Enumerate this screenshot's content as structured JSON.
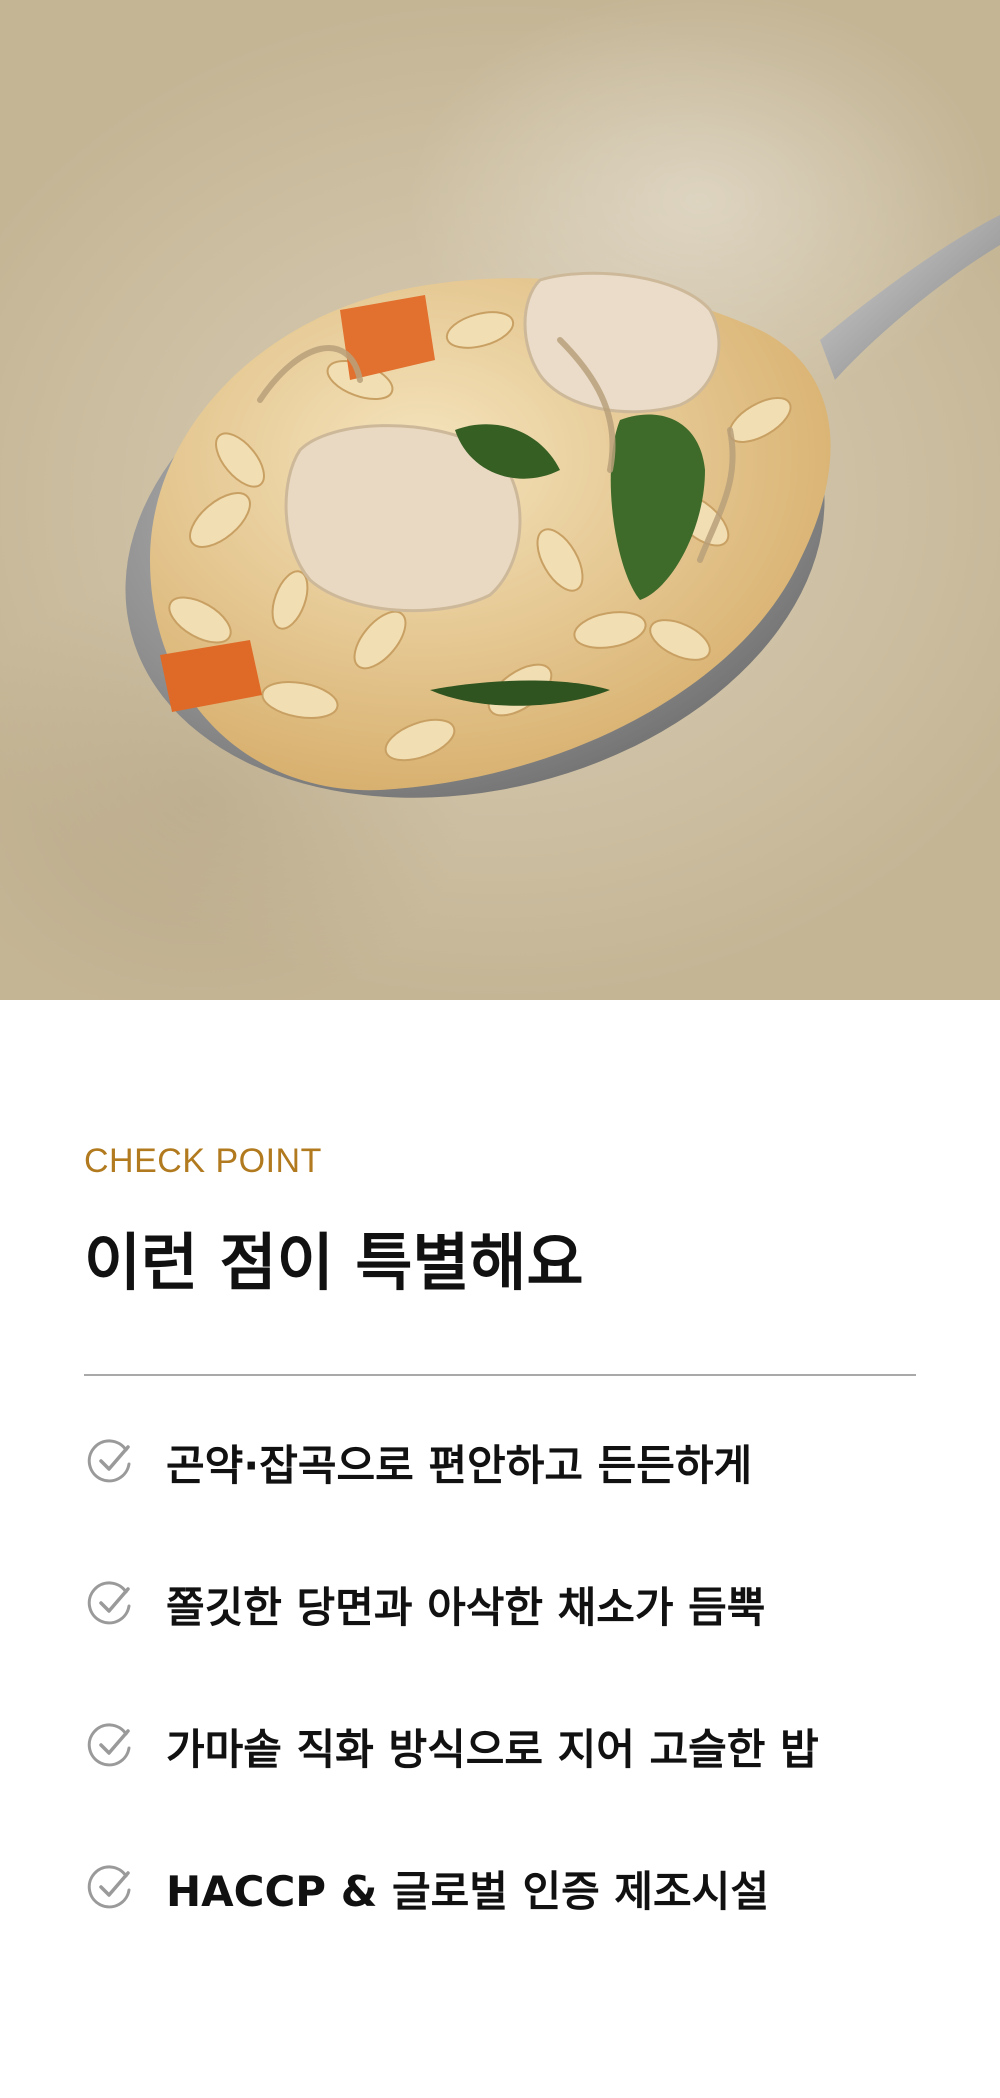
{
  "hero": {
    "image_alt": "spoonful of konjac grain rice with chicken, carrot, greens and glass noodles",
    "colors": {
      "background": "#cbbd9f",
      "spoon": "#9a9a9a",
      "rice": "#e7c98f",
      "chicken": "#ead9c2",
      "carrot": "#e2702e",
      "greens": "#3f6b2a"
    }
  },
  "section": {
    "eyebrow": "CHECK POINT",
    "title": "이런 점이 특별해요"
  },
  "checklist": {
    "icon": "check-circle-icon",
    "items": [
      {
        "label": "곤약·잡곡으로 편안하고 든든하게"
      },
      {
        "label": "쫄깃한 당면과 아삭한 채소가 듬뿍"
      },
      {
        "label": "가마솥 직화 방식으로 지어 고슬한 밥"
      },
      {
        "label": "HACCP & 글로벌 인증 제조시설"
      }
    ]
  },
  "colors": {
    "accent": "#b27a1e",
    "text": "#111111",
    "divider": "#a9a9a9",
    "icon": "#9a9a9a"
  }
}
